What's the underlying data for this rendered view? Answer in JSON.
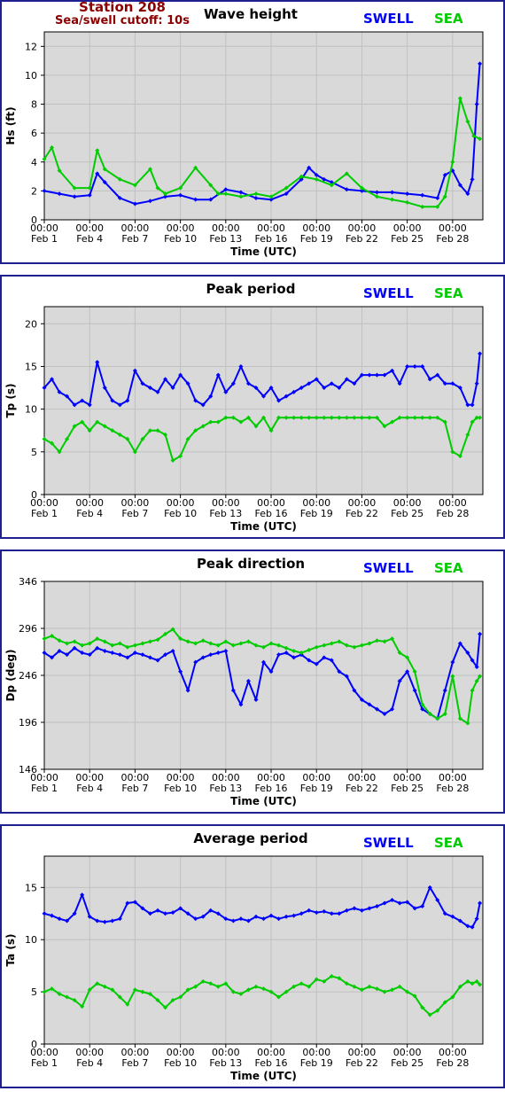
{
  "header": {
    "station": "Station 208",
    "cutoff": "Sea/swell cutoff: 10s"
  },
  "colors": {
    "swell": "#0000ff",
    "sea": "#00cc00",
    "frame": "#1f1f8f",
    "plot_bg": "#d9d9d9",
    "grid": "#c0c0c0"
  },
  "legend": {
    "swell": "SWELL",
    "sea": "SEA"
  },
  "x_axis": {
    "label": "Time (UTC)",
    "ticks": [
      {
        "t": "00:00",
        "d": "Feb 1"
      },
      {
        "t": "00:00",
        "d": "Feb 4"
      },
      {
        "t": "00:00",
        "d": "Feb 7"
      },
      {
        "t": "00:00",
        "d": "Feb 10"
      },
      {
        "t": "00:00",
        "d": "Feb 13"
      },
      {
        "t": "00:00",
        "d": "Feb 16"
      },
      {
        "t": "00:00",
        "d": "Feb 19"
      },
      {
        "t": "00:00",
        "d": "Feb 22"
      },
      {
        "t": "00:00",
        "d": "Feb 25"
      },
      {
        "t": "00:00",
        "d": "Feb 28"
      }
    ]
  },
  "chart_data": [
    {
      "type": "line",
      "title": "Wave height",
      "ylabel": "Hs (ft)",
      "xlabel": "Time (UTC)",
      "yticks": [
        0,
        2,
        4,
        6,
        8,
        10,
        12
      ],
      "ylim": [
        0,
        13
      ],
      "xlim": [
        1,
        30
      ],
      "grid": true,
      "series": [
        {
          "name": "SWELL",
          "x": [
            1,
            2,
            3,
            4,
            4.5,
            5,
            6,
            7,
            8,
            9,
            10,
            11,
            12,
            13,
            14,
            15,
            16,
            17,
            18,
            18.5,
            19,
            19.5,
            20,
            21,
            22,
            23,
            24,
            25,
            26,
            27,
            27.5,
            28,
            28.5,
            29,
            29.3,
            29.6,
            29.8
          ],
          "y": [
            2,
            1.8,
            1.6,
            1.7,
            3.2,
            2.6,
            1.5,
            1.1,
            1.3,
            1.6,
            1.7,
            1.4,
            1.4,
            2.1,
            1.9,
            1.5,
            1.4,
            1.8,
            2.8,
            3.6,
            3.1,
            2.8,
            2.6,
            2.1,
            2,
            1.9,
            1.9,
            1.8,
            1.7,
            1.5,
            3.1,
            3.4,
            2.4,
            1.8,
            2.8,
            8,
            10.8
          ]
        },
        {
          "name": "SEA",
          "x": [
            1,
            1.5,
            2,
            3,
            4,
            4.5,
            5,
            6,
            7,
            8,
            8.5,
            9,
            10,
            11,
            12,
            12.5,
            13,
            14,
            15,
            16,
            17,
            18,
            19,
            20,
            21,
            22,
            23,
            24,
            25,
            26,
            27,
            27.5,
            28,
            28.5,
            29,
            29.4,
            29.8
          ],
          "y": [
            4.2,
            5,
            3.4,
            2.2,
            2.2,
            4.8,
            3.5,
            2.8,
            2.4,
            3.5,
            2.2,
            1.8,
            2.2,
            3.6,
            2.4,
            1.8,
            1.8,
            1.6,
            1.8,
            1.6,
            2.2,
            3,
            2.8,
            2.4,
            3.2,
            2.2,
            1.6,
            1.4,
            1.2,
            0.9,
            0.9,
            1.6,
            4,
            8.4,
            6.8,
            5.8,
            5.6
          ]
        }
      ]
    },
    {
      "type": "line",
      "title": "Peak period",
      "ylabel": "Tp (s)",
      "xlabel": "Time (UTC)",
      "yticks": [
        0,
        5,
        10,
        15,
        20
      ],
      "ylim": [
        0,
        22
      ],
      "xlim": [
        1,
        30
      ],
      "grid": true,
      "series": [
        {
          "name": "SWELL",
          "x": [
            1,
            1.5,
            2,
            2.5,
            3,
            3.5,
            4,
            4.5,
            5,
            5.5,
            6,
            6.5,
            7,
            7.5,
            8,
            8.5,
            9,
            9.5,
            10,
            10.5,
            11,
            11.5,
            12,
            12.5,
            13,
            13.5,
            14,
            14.5,
            15,
            15.5,
            16,
            16.5,
            17,
            17.5,
            18,
            18.5,
            19,
            19.5,
            20,
            20.5,
            21,
            21.5,
            22,
            22.5,
            23,
            23.5,
            24,
            24.5,
            25,
            25.5,
            26,
            26.5,
            27,
            27.5,
            28,
            28.5,
            29,
            29.3,
            29.6,
            29.8
          ],
          "y": [
            12.5,
            13.5,
            12,
            11.5,
            10.5,
            11,
            10.5,
            15.5,
            12.5,
            11,
            10.5,
            11,
            14.5,
            13,
            12.5,
            12,
            13.5,
            12.5,
            14,
            13,
            11,
            10.5,
            11.5,
            14,
            12,
            13,
            15,
            13,
            12.5,
            11.5,
            12.5,
            11,
            11.5,
            12,
            12.5,
            13,
            13.5,
            12.5,
            13,
            12.5,
            13.5,
            13,
            14,
            14,
            14,
            14,
            14.5,
            13,
            15,
            15,
            15,
            13.5,
            14,
            13,
            13,
            12.5,
            10.5,
            10.5,
            13,
            16.5
          ]
        },
        {
          "name": "SEA",
          "x": [
            1,
            1.5,
            2,
            2.5,
            3,
            3.5,
            4,
            4.5,
            5,
            5.5,
            6,
            6.5,
            7,
            7.5,
            8,
            8.5,
            9,
            9.5,
            10,
            10.5,
            11,
            11.5,
            12,
            12.5,
            13,
            13.5,
            14,
            14.5,
            15,
            15.5,
            16,
            16.5,
            17,
            17.5,
            18,
            18.5,
            19,
            19.5,
            20,
            20.5,
            21,
            21.5,
            22,
            22.5,
            23,
            23.5,
            24,
            24.5,
            25,
            25.5,
            26,
            26.5,
            27,
            27.5,
            28,
            28.5,
            29,
            29.3,
            29.6,
            29.8
          ],
          "y": [
            6.5,
            6,
            5,
            6.5,
            8,
            8.5,
            7.5,
            8.5,
            8,
            7.5,
            7,
            6.5,
            5,
            6.5,
            7.5,
            7.5,
            7,
            4,
            4.5,
            6.5,
            7.5,
            8,
            8.5,
            8.5,
            9,
            9,
            8.5,
            9,
            8,
            9,
            7.5,
            9,
            9,
            9,
            9,
            9,
            9,
            9,
            9,
            9,
            9,
            9,
            9,
            9,
            9,
            8,
            8.5,
            9,
            9,
            9,
            9,
            9,
            9,
            8.5,
            5,
            4.5,
            7,
            8.5,
            9,
            9
          ]
        }
      ]
    },
    {
      "type": "line",
      "title": "Peak direction",
      "ylabel": "Dp (deg)",
      "xlabel": "Time (UTC)",
      "yticks": [
        146,
        196,
        246,
        296,
        346
      ],
      "ylim": [
        146,
        346
      ],
      "xlim": [
        1,
        30
      ],
      "grid": true,
      "series": [
        {
          "name": "SWELL",
          "x": [
            1,
            1.5,
            2,
            2.5,
            3,
            3.5,
            4,
            4.5,
            5,
            5.5,
            6,
            6.5,
            7,
            7.5,
            8,
            8.5,
            9,
            9.5,
            10,
            10.5,
            11,
            11.5,
            12,
            12.5,
            13,
            13.5,
            14,
            14.5,
            15,
            15.5,
            16,
            16.5,
            17,
            17.5,
            18,
            18.5,
            19,
            19.5,
            20,
            20.5,
            21,
            21.5,
            22,
            22.5,
            23,
            23.5,
            24,
            24.5,
            25,
            25.5,
            26,
            26.5,
            27,
            27.5,
            28,
            28.5,
            29,
            29.3,
            29.6,
            29.8
          ],
          "y": [
            270,
            265,
            272,
            268,
            275,
            270,
            268,
            275,
            272,
            270,
            268,
            265,
            270,
            268,
            265,
            262,
            268,
            272,
            250,
            230,
            260,
            265,
            268,
            270,
            272,
            230,
            215,
            240,
            220,
            260,
            250,
            268,
            270,
            265,
            268,
            262,
            258,
            265,
            262,
            250,
            245,
            230,
            220,
            215,
            210,
            205,
            210,
            240,
            250,
            230,
            210,
            205,
            200,
            230,
            260,
            280,
            270,
            262,
            255,
            290
          ]
        },
        {
          "name": "SEA",
          "x": [
            1,
            1.5,
            2,
            2.5,
            3,
            3.5,
            4,
            4.5,
            5,
            5.5,
            6,
            6.5,
            7,
            7.5,
            8,
            8.5,
            9,
            9.5,
            10,
            10.5,
            11,
            11.5,
            12,
            12.5,
            13,
            13.5,
            14,
            14.5,
            15,
            15.5,
            16,
            16.5,
            17,
            17.5,
            18,
            18.5,
            19,
            19.5,
            20,
            20.5,
            21,
            21.5,
            22,
            22.5,
            23,
            23.5,
            24,
            24.5,
            25,
            25.5,
            26,
            26.5,
            27,
            27.5,
            28,
            28.5,
            29,
            29.3,
            29.6,
            29.8
          ],
          "y": [
            285,
            288,
            283,
            280,
            282,
            278,
            280,
            285,
            282,
            278,
            280,
            276,
            278,
            280,
            282,
            284,
            290,
            295,
            285,
            282,
            280,
            283,
            280,
            278,
            282,
            278,
            280,
            282,
            278,
            276,
            280,
            278,
            275,
            272,
            270,
            273,
            276,
            278,
            280,
            282,
            278,
            276,
            278,
            280,
            283,
            282,
            285,
            270,
            265,
            250,
            215,
            205,
            200,
            205,
            245,
            200,
            195,
            230,
            240,
            245
          ]
        }
      ]
    },
    {
      "type": "line",
      "title": "Average period",
      "ylabel": "Ta (s)",
      "xlabel": "Time (UTC)",
      "yticks": [
        0,
        5,
        10,
        15
      ],
      "ylim": [
        0,
        18
      ],
      "xlim": [
        1,
        30
      ],
      "grid": true,
      "series": [
        {
          "name": "SWELL",
          "x": [
            1,
            1.5,
            2,
            2.5,
            3,
            3.5,
            4,
            4.5,
            5,
            5.5,
            6,
            6.5,
            7,
            7.5,
            8,
            8.5,
            9,
            9.5,
            10,
            10.5,
            11,
            11.5,
            12,
            12.5,
            13,
            13.5,
            14,
            14.5,
            15,
            15.5,
            16,
            16.5,
            17,
            17.5,
            18,
            18.5,
            19,
            19.5,
            20,
            20.5,
            21,
            21.5,
            22,
            22.5,
            23,
            23.5,
            24,
            24.5,
            25,
            25.5,
            26,
            26.5,
            27,
            27.5,
            28,
            28.5,
            29,
            29.3,
            29.6,
            29.8
          ],
          "y": [
            12.5,
            12.3,
            12,
            11.8,
            12.5,
            14.3,
            12.2,
            11.8,
            11.7,
            11.8,
            12,
            13.5,
            13.6,
            13,
            12.5,
            12.8,
            12.5,
            12.6,
            13,
            12.5,
            12,
            12.2,
            12.8,
            12.5,
            12,
            11.8,
            12,
            11.8,
            12.2,
            12,
            12.3,
            12,
            12.2,
            12.3,
            12.5,
            12.8,
            12.6,
            12.7,
            12.5,
            12.5,
            12.8,
            13,
            12.8,
            13,
            13.2,
            13.5,
            13.8,
            13.5,
            13.6,
            13,
            13.2,
            15,
            13.8,
            12.5,
            12.2,
            11.8,
            11.3,
            11.2,
            12,
            13.5
          ]
        },
        {
          "name": "SEA",
          "x": [
            1,
            1.5,
            2,
            2.5,
            3,
            3.5,
            4,
            4.5,
            5,
            5.5,
            6,
            6.5,
            7,
            7.5,
            8,
            8.5,
            9,
            9.5,
            10,
            10.5,
            11,
            11.5,
            12,
            12.5,
            13,
            13.5,
            14,
            14.5,
            15,
            15.5,
            16,
            16.5,
            17,
            17.5,
            18,
            18.5,
            19,
            19.5,
            20,
            20.5,
            21,
            21.5,
            22,
            22.5,
            23,
            23.5,
            24,
            24.5,
            25,
            25.5,
            26,
            26.5,
            27,
            27.5,
            28,
            28.5,
            29,
            29.3,
            29.6,
            29.8
          ],
          "y": [
            5,
            5.3,
            4.8,
            4.5,
            4.2,
            3.6,
            5.2,
            5.8,
            5.5,
            5.2,
            4.5,
            3.8,
            5.2,
            5,
            4.8,
            4.2,
            3.5,
            4.2,
            4.5,
            5.2,
            5.5,
            6,
            5.8,
            5.5,
            5.8,
            5,
            4.8,
            5.2,
            5.5,
            5.3,
            5,
            4.5,
            5,
            5.5,
            5.8,
            5.5,
            6.2,
            6,
            6.5,
            6.3,
            5.8,
            5.5,
            5.2,
            5.5,
            5.3,
            5,
            5.2,
            5.5,
            5,
            4.6,
            3.5,
            2.8,
            3.2,
            4,
            4.5,
            5.5,
            6,
            5.8,
            6,
            5.7
          ]
        }
      ]
    }
  ]
}
